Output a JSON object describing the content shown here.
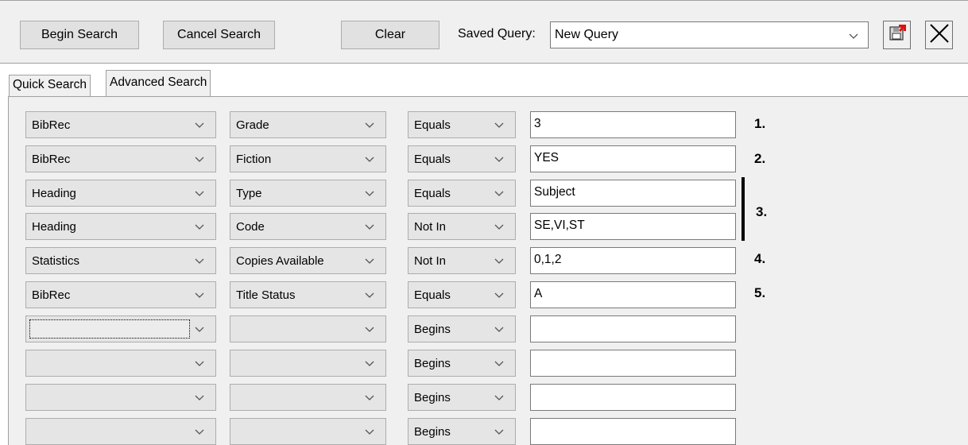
{
  "toolbar": {
    "begin_search": "Begin Search",
    "cancel_search": "Cancel Search",
    "clear": "Clear",
    "saved_query_label": "Saved Query:",
    "saved_query_value": "New Query",
    "save_icon": "save-query-icon",
    "close_icon": "close-icon"
  },
  "tabs": [
    {
      "label": "Quick Search",
      "active": false
    },
    {
      "label": "Advanced Search",
      "active": true
    }
  ],
  "rows": [
    {
      "table": "BibRec",
      "field": "Grade",
      "op": "Equals",
      "value": "3"
    },
    {
      "table": "BibRec",
      "field": "Fiction",
      "op": "Equals",
      "value": "YES"
    },
    {
      "table": "Heading",
      "field": "Type",
      "op": "Equals",
      "value": "Subject"
    },
    {
      "table": "Heading",
      "field": "Code",
      "op": "Not In",
      "value": "SE,VI,ST"
    },
    {
      "table": "Statistics",
      "field": "Copies Available",
      "op": "Not In",
      "value": "0,1,2"
    },
    {
      "table": "BibRec",
      "field": "Title Status",
      "op": "Equals",
      "value": "A"
    },
    {
      "table": "",
      "field": "",
      "op": "Begins",
      "value": ""
    },
    {
      "table": "",
      "field": "",
      "op": "Begins",
      "value": ""
    },
    {
      "table": "",
      "field": "",
      "op": "Begins",
      "value": ""
    },
    {
      "table": "",
      "field": "",
      "op": "Begins",
      "value": ""
    }
  ],
  "annotations": [
    "1.",
    "2.",
    "3.",
    "4.",
    "5."
  ]
}
